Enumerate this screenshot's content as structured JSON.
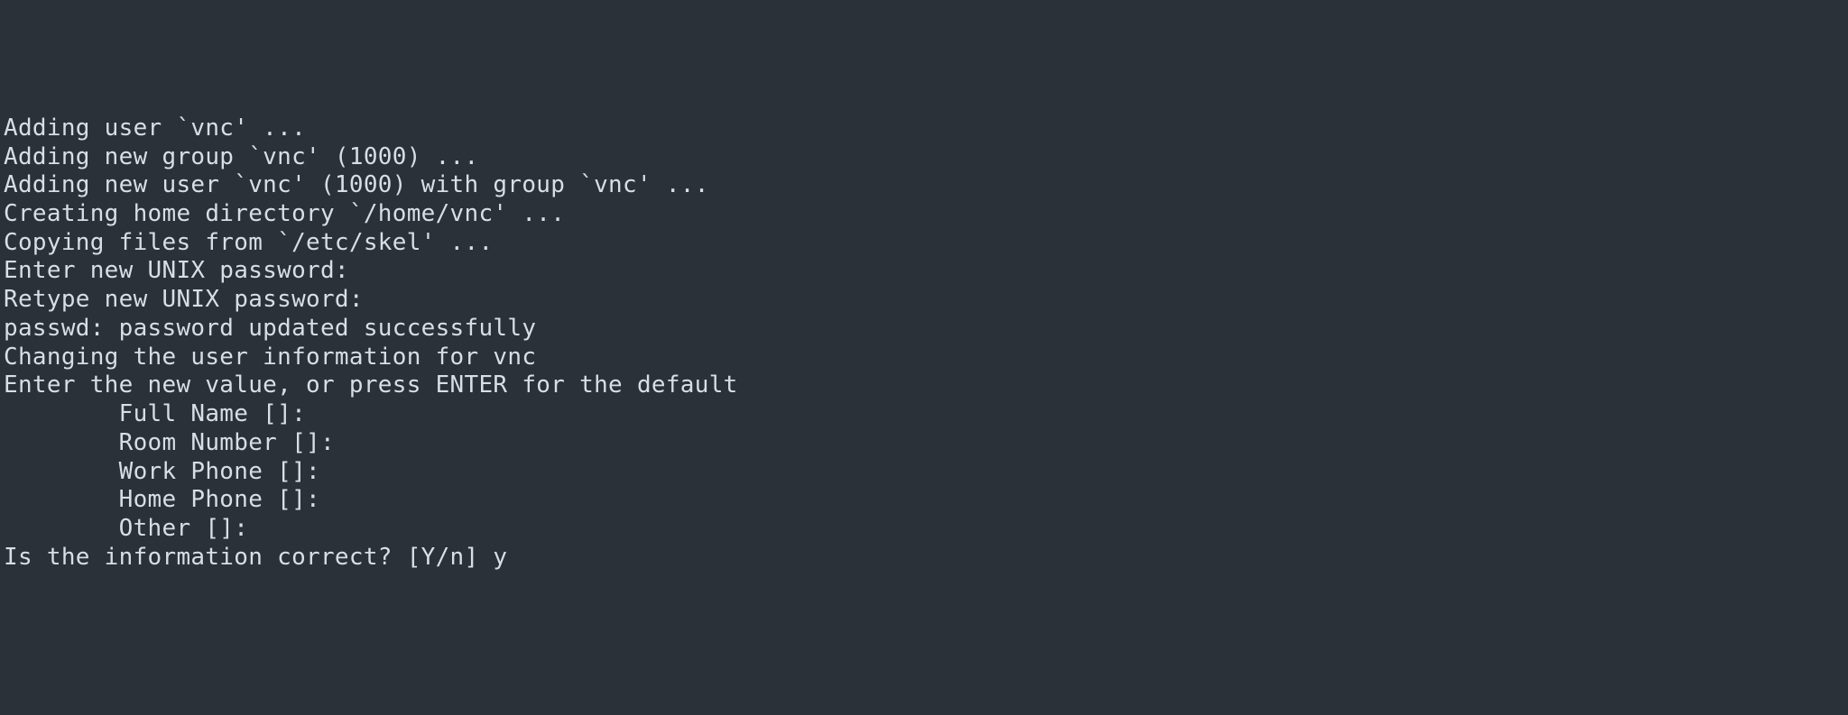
{
  "lines": [
    "Adding user `vnc' ...",
    "Adding new group `vnc' (1000) ...",
    "Adding new user `vnc' (1000) with group `vnc' ...",
    "Creating home directory `/home/vnc' ...",
    "Copying files from `/etc/skel' ...",
    "Enter new UNIX password: ",
    "Retype new UNIX password: ",
    "passwd: password updated successfully",
    "Changing the user information for vnc",
    "Enter the new value, or press ENTER for the default",
    "        Full Name []: ",
    "        Room Number []: ",
    "        Work Phone []: ",
    "        Home Phone []: ",
    "        Other []: ",
    "Is the information correct? [Y/n] y"
  ]
}
